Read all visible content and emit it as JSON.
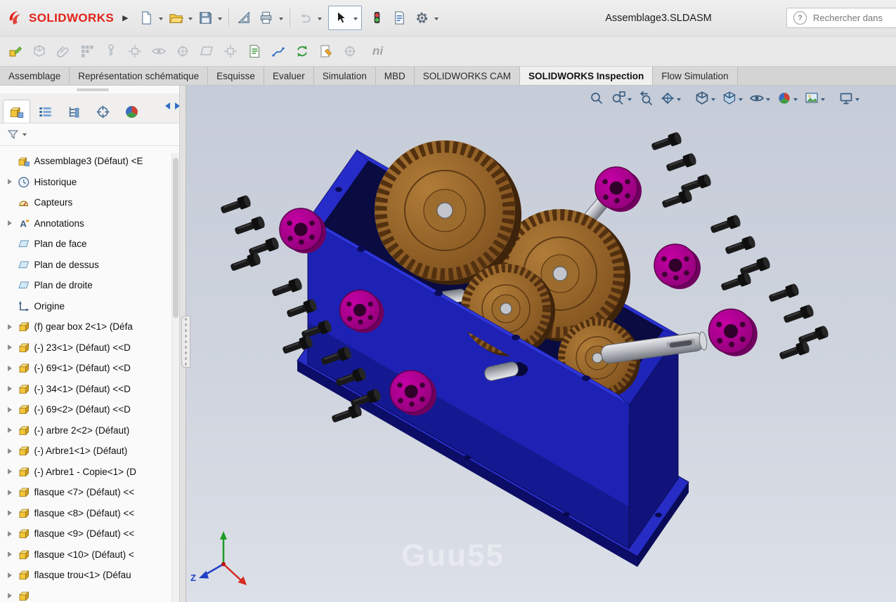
{
  "titlebar": {
    "brand": "SOLIDWORKS",
    "document_title": "Assemblage3.SLDASM",
    "search_placeholder": "Rechercher dans",
    "toolbar_icons": [
      "new-file",
      "open",
      "save",
      "make-drawing",
      "print",
      "undo",
      "select",
      "rebuild",
      "file-properties",
      "options"
    ]
  },
  "assembly_toolbar": {
    "icons": [
      "edit-component",
      "insert-components",
      "mate",
      "linear-component-pattern",
      "smart-fasteners",
      "move-component",
      "show-hidden-components",
      "assembly-features",
      "reference-geometry",
      "bill-of-materials",
      "exploded-view",
      "explode-line-sketch",
      "update-assembly",
      "clearance-verification",
      "hole-alignment"
    ],
    "ni_label": "ni"
  },
  "command_tabs": {
    "items": [
      "Assemblage",
      "Représentation schématique",
      "Esquisse",
      "Evaluer",
      "Simulation",
      "MBD",
      "SOLIDWORKS CAM",
      "SOLIDWORKS Inspection",
      "Flow Simulation"
    ],
    "active": "SOLIDWORKS Inspection"
  },
  "panel": {
    "manager_tabs": [
      "featuremanager",
      "propertymanager",
      "configurationmanager",
      "dimxpertmanager",
      "displaymanager"
    ],
    "tree_items": [
      {
        "label": "Assemblage3 (Défaut) <E"
      },
      {
        "label": "Historique"
      },
      {
        "label": "Capteurs"
      },
      {
        "label": "Annotations"
      },
      {
        "label": "Plan de face"
      },
      {
        "label": "Plan de dessus"
      },
      {
        "label": "Plan de droite"
      },
      {
        "label": "Origine"
      },
      {
        "label": "(f) gear box 2<1> (Défa"
      },
      {
        "label": "(-) 23<1> (Défaut) <<D"
      },
      {
        "label": "(-) 69<1> (Défaut) <<D"
      },
      {
        "label": "(-) 34<1> (Défaut) <<D"
      },
      {
        "label": "(-) 69<2> (Défaut) <<D"
      },
      {
        "label": "(-) arbre 2<2> (Défaut)"
      },
      {
        "label": "(-) Arbre1<1> (Défaut)"
      },
      {
        "label": "(-) Arbre1 - Copie<1> (D"
      },
      {
        "label": "flasque <7> (Défaut) <<"
      },
      {
        "label": "flasque <8> (Défaut) <<"
      },
      {
        "label": "flasque <9> (Défaut) <<"
      },
      {
        "label": "flasque <10> (Défaut) <"
      },
      {
        "label": "flasque trou<1> (Défau"
      }
    ]
  },
  "viewport": {
    "headsup_icons": [
      "zoom-to-fit",
      "zoom-to-area",
      "previous-view",
      "section-view",
      "view-orientation",
      "display-style",
      "hide-show-items",
      "edit-appearance",
      "apply-scene",
      "view-settings"
    ],
    "watermark": "Guu55",
    "triad_z_label": "Z"
  },
  "colors": {
    "brand_red": "#e2231a",
    "housing_front": "#1d22b4",
    "housing_rim": "#2e36da",
    "housing_end": "#11137a",
    "housing_interior": "#0a0b40",
    "gear_light": "#b07c38",
    "gear_dark": "#7c4e1c",
    "flange_light": "#c500a5",
    "flange_dark": "#8f0077",
    "bolt_black": "#191919",
    "shaft_gray": "#c2c5cb"
  }
}
